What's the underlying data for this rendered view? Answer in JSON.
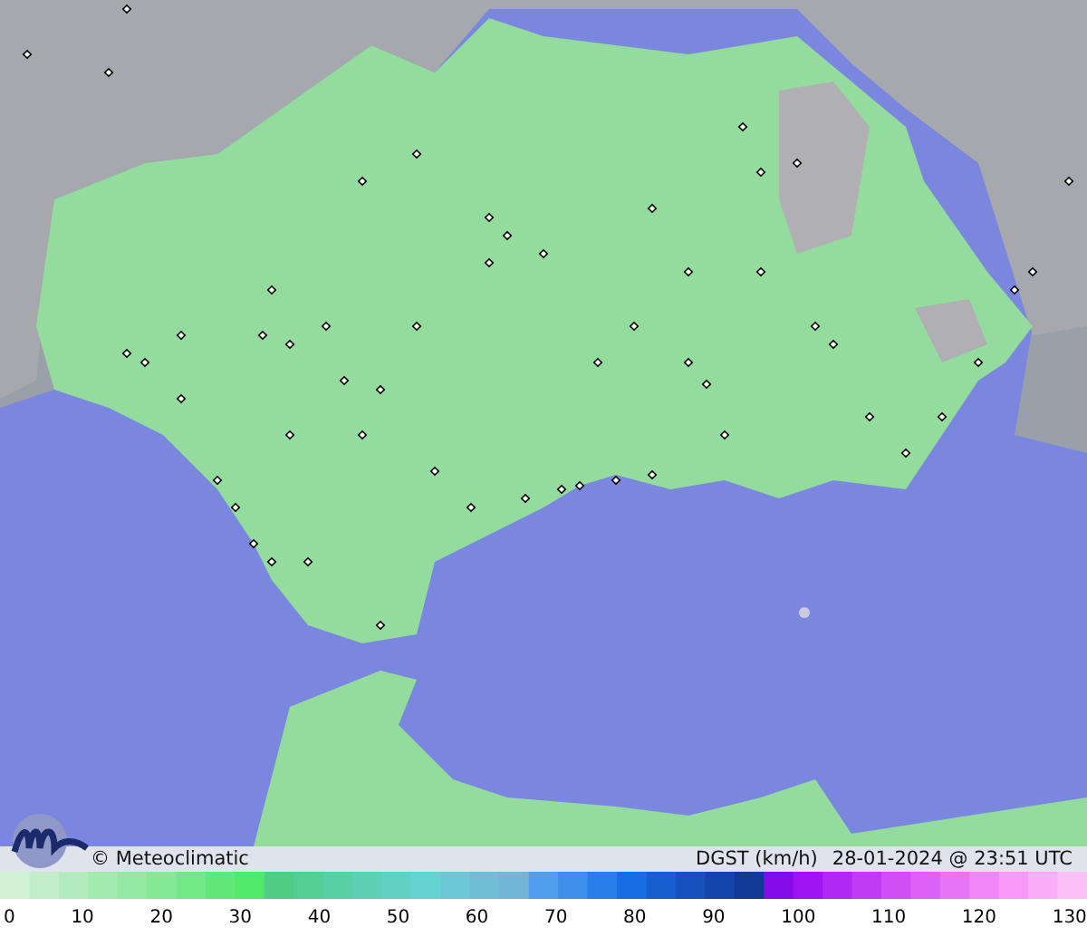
{
  "credit": "© Meteoclimatic",
  "title": "DGST (km/h)",
  "timestamp": "28-01-2024 @ 23:51 UTC",
  "legend": {
    "ticks": [
      "0",
      "10",
      "20",
      "30",
      "40",
      "50",
      "60",
      "70",
      "80",
      "90",
      "100",
      "110",
      "120",
      "130"
    ]
  }
}
